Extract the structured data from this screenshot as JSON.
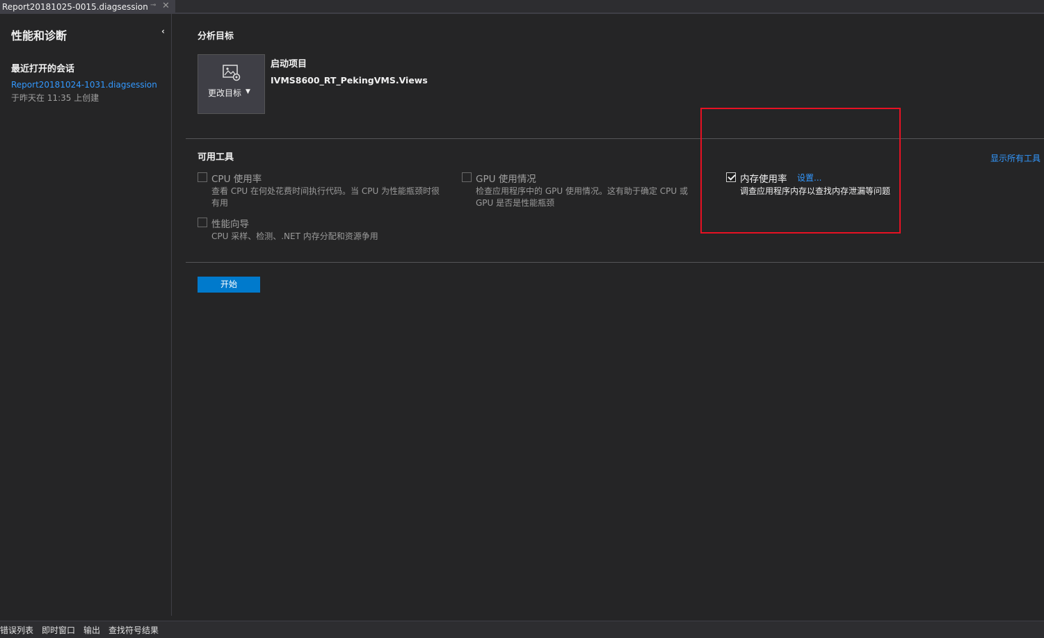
{
  "document_tab": {
    "title": "Report20181025-0015.diagsession",
    "pin_glyph": "⊸",
    "close_glyph": "✕"
  },
  "sidebar": {
    "title": "性能和诊断",
    "collapse_glyph": "‹",
    "recent_heading": "最近打开的会话",
    "recent_sessions": [
      {
        "name": "Report20181024-1031.diagsession",
        "created": "于昨天在 11:35 上创建"
      }
    ]
  },
  "analysis_target": {
    "heading": "分析目标",
    "change_target_label": "更改目标",
    "startup_heading": "启动项目",
    "startup_project": "IVMS8600_RT_PekingVMS.Views"
  },
  "tools": {
    "heading": "可用工具",
    "show_all_label": "显示所有工具",
    "items": [
      {
        "name": "CPU 使用率",
        "description_line1": "查看 CPU 在何处花费时间执行代码。当 CPU 为性能瓶颈时很",
        "description_line2": "有用",
        "checked": false
      },
      {
        "name": "GPU 使用情况",
        "description_line1": "检查应用程序中的 GPU 使用情况。这有助于确定 CPU 或",
        "description_line2": "GPU 是否是性能瓶颈",
        "checked": false
      },
      {
        "name": "内存使用率",
        "settings_label": "设置...",
        "description_line1": "调查应用程序内存以查找内存泄漏等问题",
        "description_line2": "",
        "checked": true
      },
      {
        "name": "性能向导",
        "description_line1": "CPU 采样、检测、.NET 内存分配和资源争用",
        "description_line2": "",
        "checked": false
      }
    ]
  },
  "start_button_label": "开始",
  "bottom_tabs": [
    "错误列表",
    "即时窗口",
    "输出",
    "查找符号结果"
  ],
  "colors": {
    "background": "#252526",
    "accent": "#007acc",
    "link": "#3399ff",
    "highlight": "#e81123"
  }
}
